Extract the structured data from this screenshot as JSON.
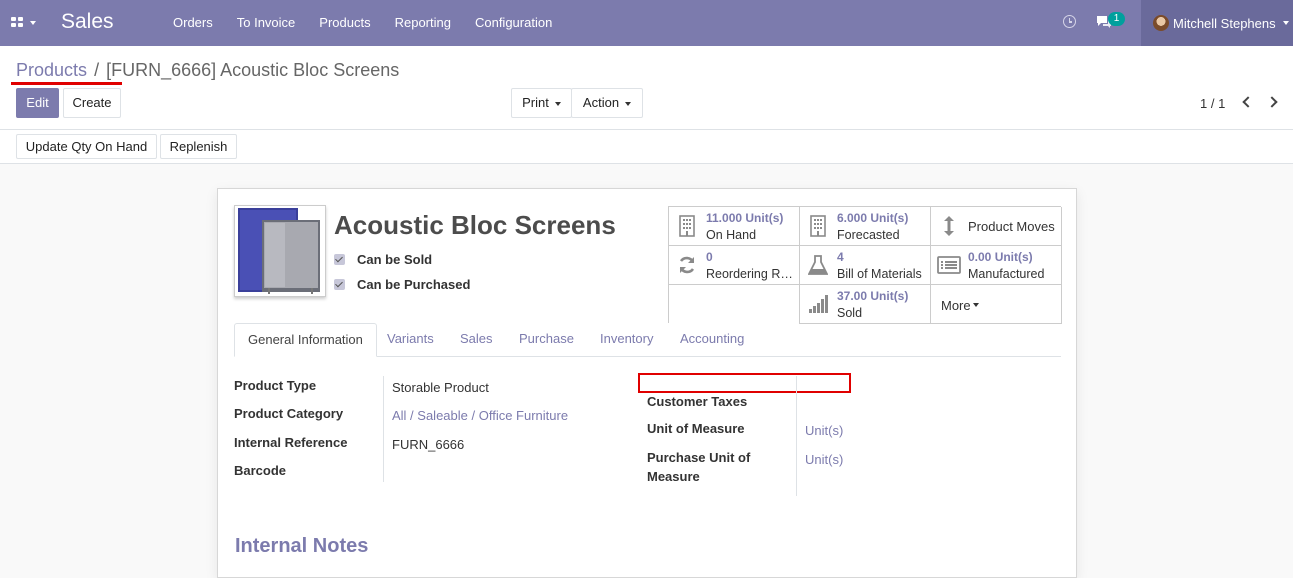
{
  "navbar": {
    "app_name": "Sales",
    "menu": [
      "Orders",
      "To Invoice",
      "Products",
      "Reporting",
      "Configuration"
    ],
    "chat_badge": "1",
    "user_name": "Mitchell Stephens",
    "accent": "#7c7bad"
  },
  "breadcrumb": {
    "parent": "Products",
    "separator": "/",
    "current": "[FURN_6666] Acoustic Bloc Screens"
  },
  "control": {
    "edit_label": "Edit",
    "create_label": "Create",
    "print_label": "Print",
    "action_label": "Action",
    "pager": "1 / 1"
  },
  "statusbar": {
    "update_qty_label": "Update Qty On Hand",
    "replenish_label": "Replenish"
  },
  "product": {
    "name": "Acoustic Bloc Screens",
    "can_be_sold_label": "Can be Sold",
    "can_be_purchased_label": "Can be Purchased"
  },
  "smart_buttons": {
    "on_hand": {
      "value": "11.000 Unit(s)",
      "label": "On Hand",
      "icon": "building-icon"
    },
    "forecasted": {
      "value": "6.000 Unit(s)",
      "label": "Forecasted",
      "icon": "building-icon"
    },
    "product_moves": {
      "label": "Product Moves",
      "icon": "arrows-vertical-icon"
    },
    "reordering": {
      "value": "0",
      "label": "Reordering Rules",
      "icon": "refresh-icon"
    },
    "bom": {
      "value": "4",
      "label": "Bill of Materials",
      "icon": "flask-icon"
    },
    "manufactured": {
      "value": "0.00 Unit(s)",
      "label": "Manufactured",
      "icon": "list-icon"
    },
    "sold": {
      "value": "37.00 Unit(s)",
      "label": "Sold",
      "icon": "signal-icon"
    },
    "more_label": "More"
  },
  "tabs": [
    "General Information",
    "Variants",
    "Sales",
    "Purchase",
    "Inventory",
    "Accounting"
  ],
  "general": {
    "product_type": {
      "label": "Product Type",
      "value": "Storable Product"
    },
    "product_category": {
      "label": "Product Category",
      "value": "All / Saleable / Office Furniture"
    },
    "internal_reference": {
      "label": "Internal Reference",
      "value": "FURN_6666"
    },
    "barcode": {
      "label": "Barcode",
      "value": ""
    },
    "customer_taxes": {
      "label": "Customer Taxes",
      "value": ""
    },
    "unit_of_measure": {
      "label": "Unit of Measure",
      "value": "Unit(s)"
    },
    "purchase_uom": {
      "label_line1": "Purchase Unit of",
      "label_line2": "Measure",
      "value": "Unit(s)"
    }
  },
  "notes": {
    "title": "Internal Notes"
  }
}
